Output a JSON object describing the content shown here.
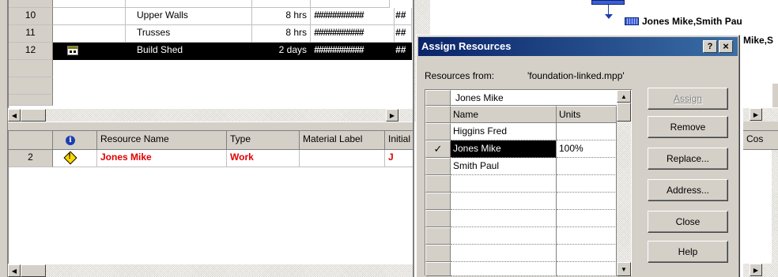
{
  "task_table": {
    "rows": [
      {
        "id": "",
        "name": "",
        "duration": "",
        "start": ""
      },
      {
        "id": "10",
        "name": "Upper Walls",
        "duration": "8 hrs",
        "start": "###########",
        "extra": "##"
      },
      {
        "id": "11",
        "name": "Trusses",
        "duration": "8 hrs",
        "start": "###########",
        "extra": "##"
      },
      {
        "id": "12",
        "name": "Build Shed",
        "duration": "2 days",
        "start": "###########",
        "extra": "##"
      }
    ]
  },
  "resource_table": {
    "headers": [
      "",
      "Resource Name",
      "Type",
      "Material Label",
      "Initial"
    ],
    "rows": [
      {
        "id": "2",
        "name": "Jones Mike",
        "type": "Work",
        "material": "",
        "initial": "J"
      }
    ]
  },
  "gantt": {
    "label1": "Jones Mike,Smith Pau",
    "label2": "Mike,S",
    "cost_header": "Cos"
  },
  "dialog": {
    "title": "Assign Resources",
    "help_btn": "?",
    "close_btn": "×",
    "resources_from_label": "Resources from:",
    "resources_from_value": "'foundation-linked.mpp'",
    "edit_value": "Jones Mike",
    "columns": {
      "name": "Name",
      "units": "Units"
    },
    "rows": [
      {
        "check": "",
        "name": "Higgins Fred",
        "units": ""
      },
      {
        "check": "✓",
        "name": "Jones Mike",
        "units": "100%"
      },
      {
        "check": "",
        "name": "Smith Paul",
        "units": ""
      }
    ],
    "buttons": {
      "assign": "Assign",
      "remove": "Remove",
      "replace": "Replace...",
      "address": "Address...",
      "close": "Close",
      "help": "Help"
    }
  },
  "colors": {
    "selected_bg": "#000000",
    "dialog_title_bg": "#0a246a",
    "resource_red": "#e00000",
    "gantt_bar": "#3b5ed8"
  }
}
